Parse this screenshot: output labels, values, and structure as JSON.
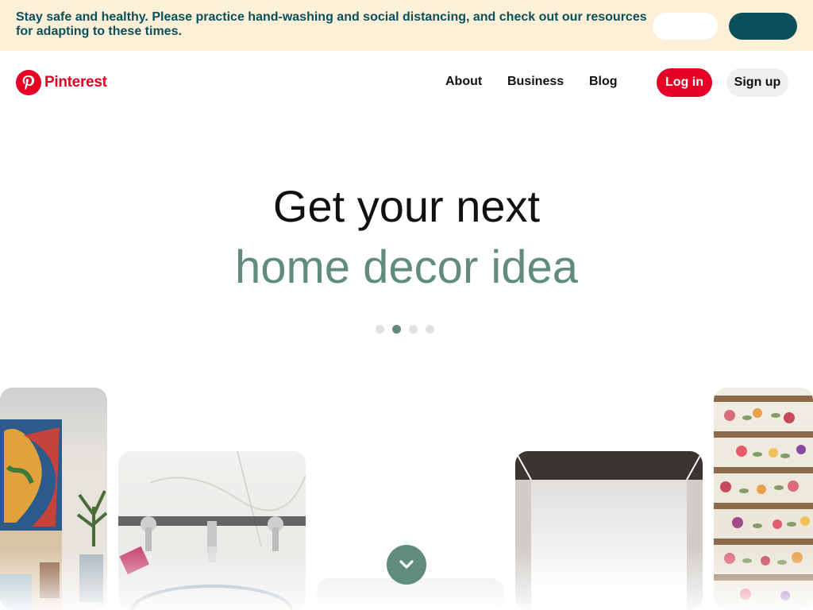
{
  "banner": {
    "text": "Stay safe and healthy. Please practice hand-washing and social distancing, and check out our resources for adapting to these times.",
    "button_1": "",
    "button_2": ""
  },
  "header": {
    "logo_text": "Pinterest",
    "nav": [
      "About",
      "Business",
      "Blog"
    ],
    "login_label": "Log in",
    "signup_label": "Sign up"
  },
  "hero": {
    "line1": "Get your next",
    "line2": "home decor idea",
    "dot_count": 4,
    "active_dot": 1
  },
  "colors": {
    "brand_red": "#e60023",
    "accent_green": "#618c7b",
    "banner_bg": "#fdf0d9",
    "banner_text": "#0a4f5a"
  },
  "icons": {
    "logo": "pinterest-logo-icon",
    "scroll": "chevron-down-icon"
  }
}
